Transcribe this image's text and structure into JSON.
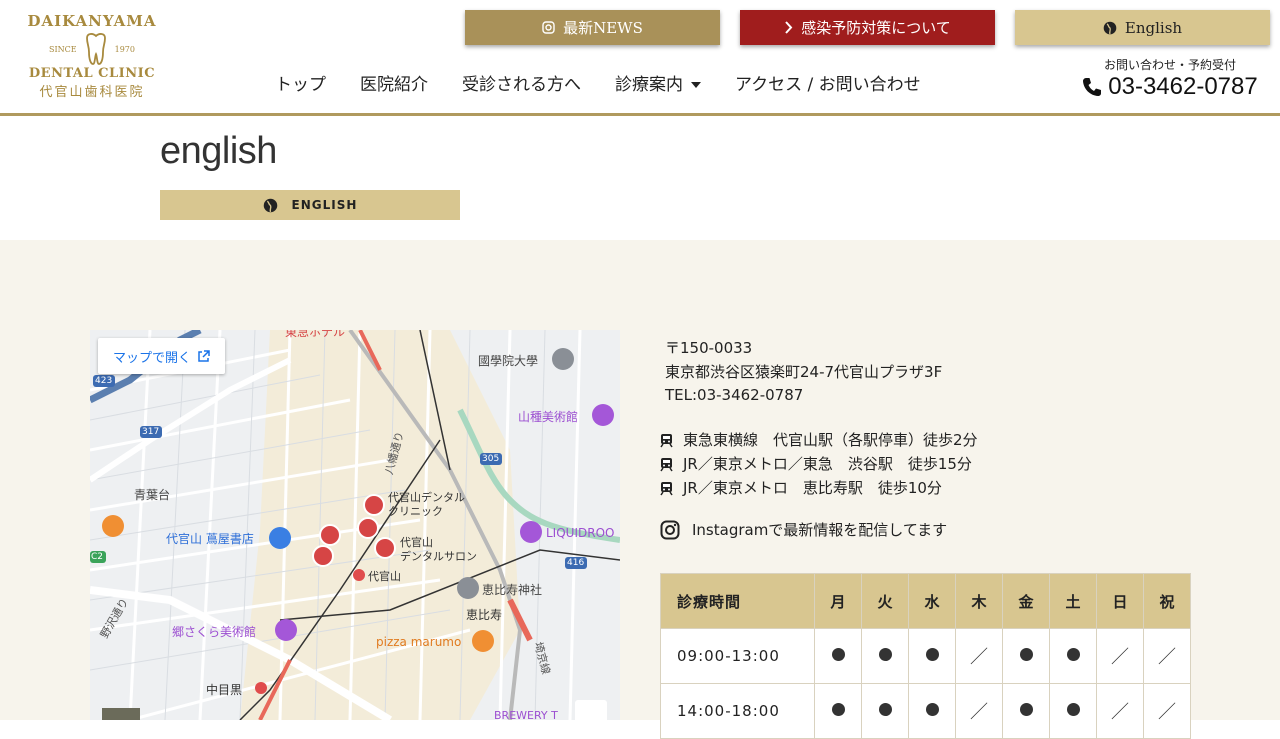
{
  "header": {
    "logo": {
      "line1": "DAIKANYAMA",
      "since": "SINCE",
      "year": "1970",
      "line3": "DENTAL CLINIC",
      "line4": "代官山歯科医院"
    },
    "buttons": {
      "news": "最新NEWS",
      "covid": "感染予防対策について",
      "english": "English"
    },
    "nav": [
      "トップ",
      "医院紹介",
      "受診される方へ",
      "診療案内",
      "アクセス / お問い合わせ"
    ],
    "contact": {
      "label": "お問い合わせ・予約受付",
      "tel": "03-3462-0787"
    },
    "colors": {
      "gold": "#a99159",
      "red": "#a01d1d",
      "light_gold": "#d8c690"
    }
  },
  "page": {
    "title": "english",
    "eng_bar_label": "ENGLISH"
  },
  "map": {
    "open_label": "マップで開く",
    "labels": {
      "hotel": "東急ホテル",
      "university": "國學院大學",
      "museum": "山種美術館",
      "aobadai": "青葉台",
      "tsutaya": "代官山 蔦屋書店",
      "clinic1a": "代官山デンタル",
      "clinic1b": "クリニック",
      "clinic2a": "代官山",
      "clinic2b": "デンタルサロン",
      "daikanyama": "代官山",
      "ebisu_shrine": "恵比寿神社",
      "ebisu": "恵比寿",
      "liquidroom": "LIQUIDROO",
      "gosakura": "郷さくら美術館",
      "pizza": "pizza marumo",
      "nakameguro": "中目黒",
      "hachiman": "八幡通り",
      "nozawa": "野沢通り",
      "brewery": "BREWERY T",
      "saikyo": "埼京線",
      "r423": "423",
      "r317": "317",
      "r305": "305",
      "r416": "416",
      "c2": "C2"
    }
  },
  "address": {
    "zip": "〒150-0033",
    "street": "東京都渋谷区猿楽町24-7代官山プラザ3F",
    "tel": "TEL:03-3462-0787"
  },
  "access": [
    "東急東横線　代官山駅（各駅停車）徒歩2分",
    "JR／東京メトロ／東急　渋谷駅　徒歩15分",
    "JR／東京メトロ　恵比寿駅　徒歩10分"
  ],
  "instagram": "Instagramで最新情報を配信してます",
  "hours": {
    "header": [
      "診療時間",
      "月",
      "火",
      "水",
      "木",
      "金",
      "土",
      "日",
      "祝"
    ],
    "rows": [
      {
        "time": "09:00-13:00",
        "marks": [
          "dot",
          "dot",
          "dot",
          "slash",
          "dot",
          "dot",
          "slash",
          "slash"
        ]
      },
      {
        "time": "14:00-18:00",
        "marks": [
          "dot",
          "dot",
          "dot",
          "slash",
          "dot",
          "dot",
          "slash",
          "slash"
        ]
      }
    ],
    "slash_symbol": "／"
  }
}
